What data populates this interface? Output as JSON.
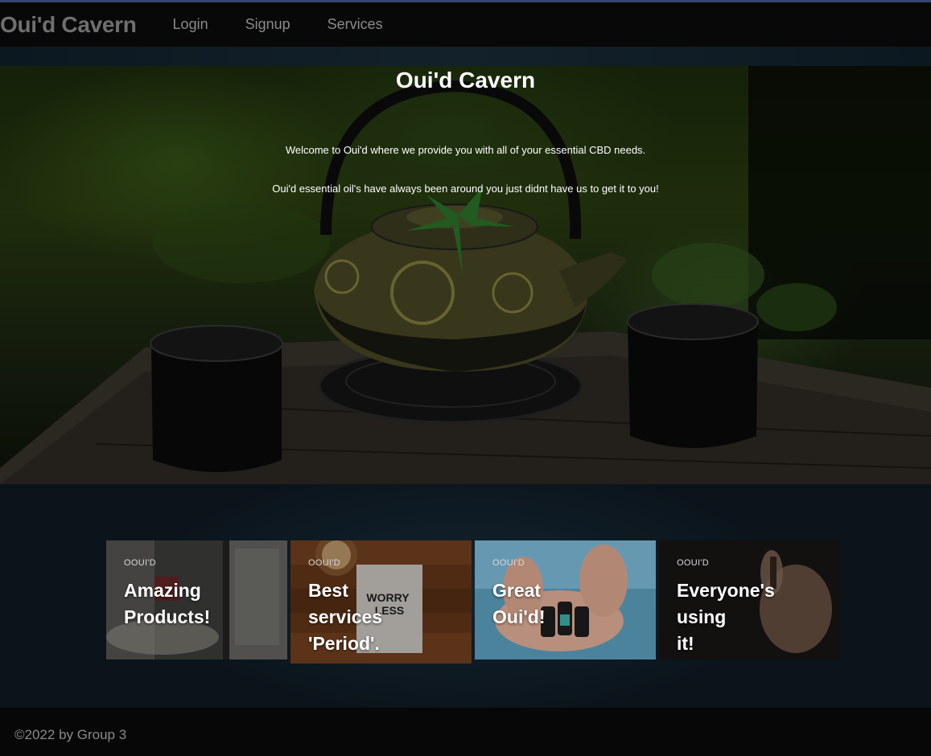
{
  "nav": {
    "brand": "Oui'd Cavern",
    "links": [
      "Login",
      "Signup",
      "Services"
    ]
  },
  "hero": {
    "title": "Oui'd Cavern",
    "line1": "Welcome to Oui'd where we provide you with all of your essential CBD needs.",
    "line2": "Oui'd essential oil's have always been around you just didnt have us to get it to you!"
  },
  "cards": [
    {
      "eyebrow": "OOUI'D",
      "title_lines": [
        "Amazing",
        "Products!"
      ]
    },
    {
      "eyebrow": "OOUI'D",
      "title_lines": [
        "Best",
        "services",
        "'Period'."
      ],
      "sign": [
        "WORRY",
        "LESS"
      ]
    },
    {
      "eyebrow": "OOUI'D",
      "title_lines": [
        "Great",
        "Oui'd!"
      ]
    },
    {
      "eyebrow": "OOUI'D",
      "title_lines": [
        "Everyone's",
        "using",
        "it!"
      ]
    }
  ],
  "footer": {
    "text": "©2022 by Group 3"
  },
  "colors": {
    "navbar": "#080808",
    "nav_text": "#8a8a8a",
    "footer": "#070707",
    "lower_bg": "#0f1a22"
  }
}
